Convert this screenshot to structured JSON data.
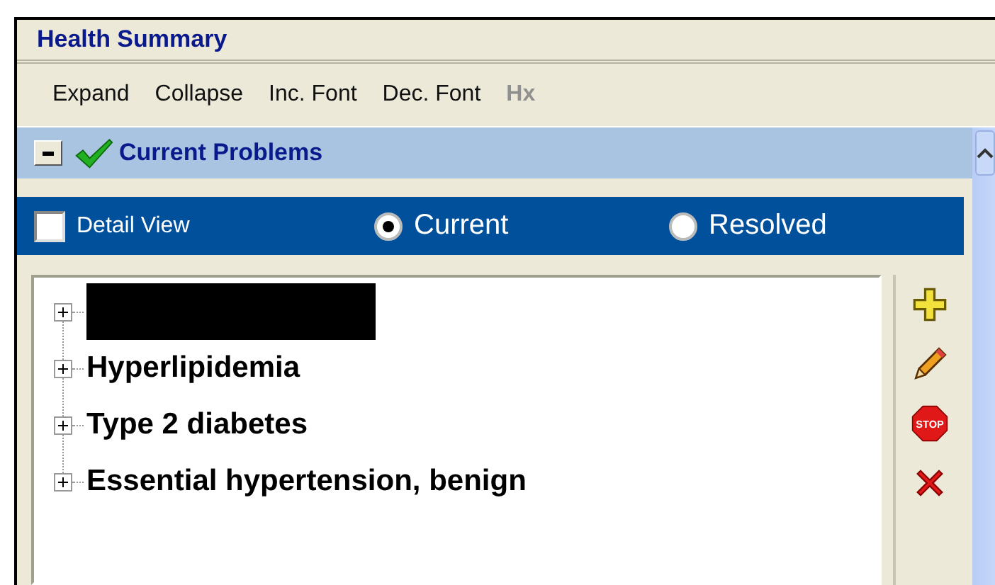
{
  "window": {
    "title": "Health Summary"
  },
  "toolbar": [
    {
      "label": "Expand",
      "disabled": false
    },
    {
      "label": "Collapse",
      "disabled": false
    },
    {
      "label": "Inc. Font",
      "disabled": false
    },
    {
      "label": "Dec. Font",
      "disabled": false
    },
    {
      "label": "Hx",
      "disabled": true
    }
  ],
  "section": {
    "title": "Current Problems",
    "expanded": true
  },
  "filters": {
    "detail_view": {
      "label": "Detail View",
      "checked": false
    },
    "radios": [
      {
        "label": "Current",
        "selected": true
      },
      {
        "label": "Resolved",
        "selected": false
      }
    ]
  },
  "problems": [
    {
      "kind": "redacted"
    },
    {
      "kind": "text",
      "label": "Hyperlipidemia"
    },
    {
      "kind": "text",
      "label": "Type 2 diabetes"
    },
    {
      "kind": "text",
      "label": "Essential hypertension, benign"
    }
  ],
  "actions": [
    {
      "kind": "add"
    },
    {
      "kind": "edit"
    },
    {
      "kind": "stop",
      "label": "STOP"
    },
    {
      "kind": "delete"
    }
  ]
}
